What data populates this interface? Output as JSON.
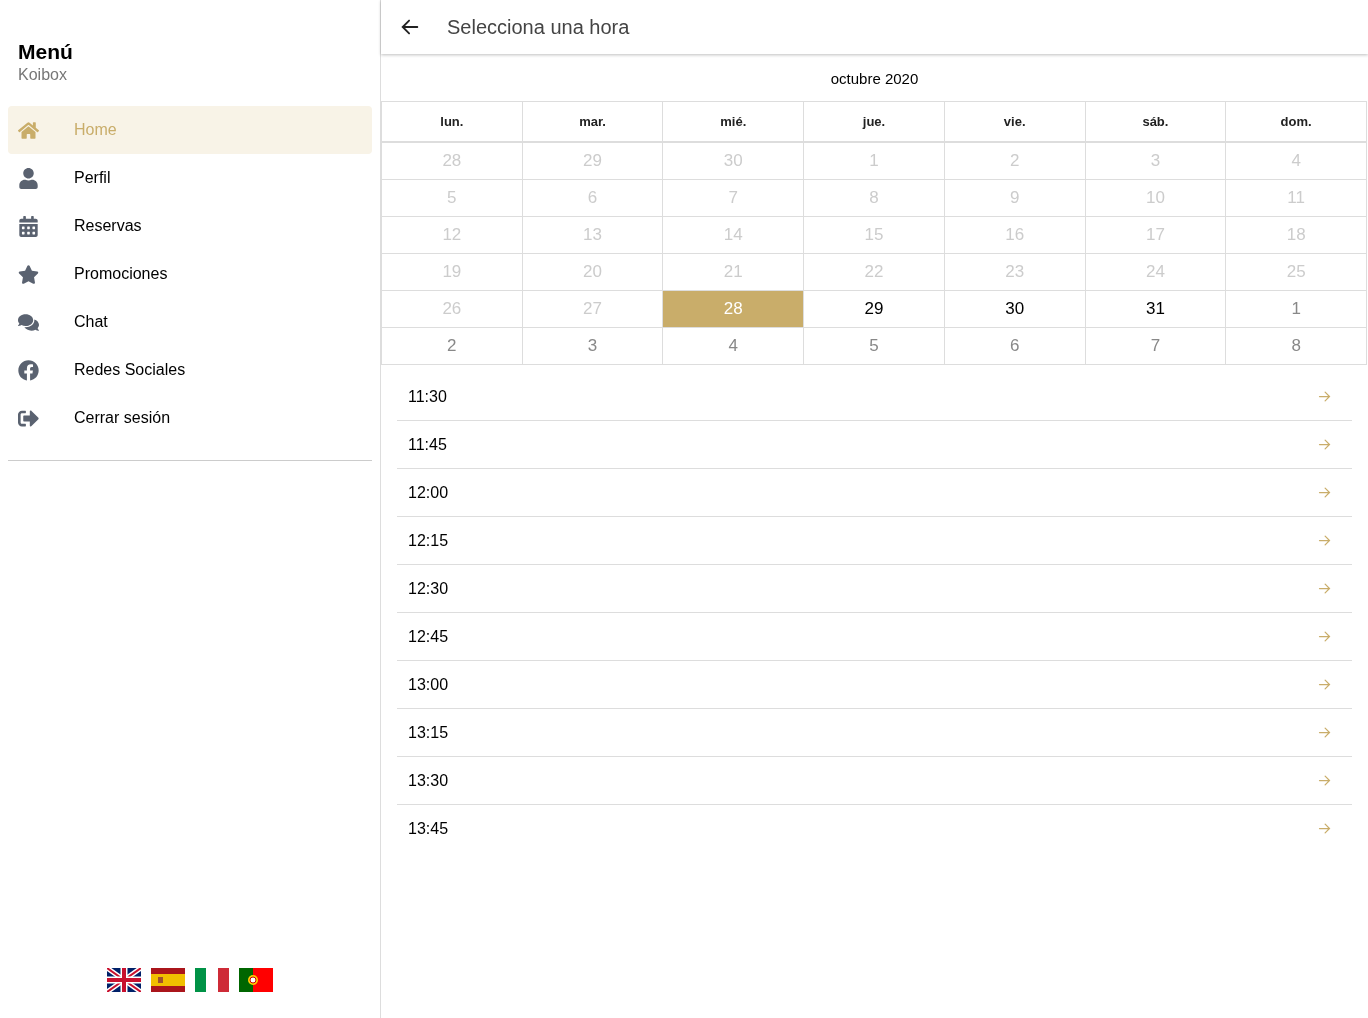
{
  "sidebar": {
    "title": "Menú",
    "subtitle": "Koibox",
    "items": [
      {
        "label": "Home",
        "selected": true
      },
      {
        "label": "Perfil",
        "selected": false
      },
      {
        "label": "Reservas",
        "selected": false
      },
      {
        "label": "Promociones",
        "selected": false
      },
      {
        "label": "Chat",
        "selected": false
      },
      {
        "label": "Redes Sociales",
        "selected": false
      },
      {
        "label": "Cerrar sesión",
        "selected": false
      }
    ]
  },
  "header": {
    "title": "Selecciona una hora"
  },
  "calendar": {
    "month": "octubre 2020",
    "weekdays": [
      "lun.",
      "mar.",
      "mié.",
      "jue.",
      "vie.",
      "sáb.",
      "dom."
    ],
    "weeks": [
      [
        {
          "day": "28",
          "disabled": true,
          "selected": false
        },
        {
          "day": "29",
          "disabled": true,
          "selected": false
        },
        {
          "day": "30",
          "disabled": true,
          "selected": false
        },
        {
          "day": "1",
          "disabled": true,
          "selected": false
        },
        {
          "day": "2",
          "disabled": true,
          "selected": false
        },
        {
          "day": "3",
          "disabled": true,
          "selected": false
        },
        {
          "day": "4",
          "disabled": true,
          "selected": false
        }
      ],
      [
        {
          "day": "5",
          "disabled": true,
          "selected": false
        },
        {
          "day": "6",
          "disabled": true,
          "selected": false
        },
        {
          "day": "7",
          "disabled": true,
          "selected": false
        },
        {
          "day": "8",
          "disabled": true,
          "selected": false
        },
        {
          "day": "9",
          "disabled": true,
          "selected": false
        },
        {
          "day": "10",
          "disabled": true,
          "selected": false
        },
        {
          "day": "11",
          "disabled": true,
          "selected": false
        }
      ],
      [
        {
          "day": "12",
          "disabled": true,
          "selected": false
        },
        {
          "day": "13",
          "disabled": true,
          "selected": false
        },
        {
          "day": "14",
          "disabled": true,
          "selected": false
        },
        {
          "day": "15",
          "disabled": true,
          "selected": false
        },
        {
          "day": "16",
          "disabled": true,
          "selected": false
        },
        {
          "day": "17",
          "disabled": true,
          "selected": false
        },
        {
          "day": "18",
          "disabled": true,
          "selected": false
        }
      ],
      [
        {
          "day": "19",
          "disabled": true,
          "selected": false
        },
        {
          "day": "20",
          "disabled": true,
          "selected": false
        },
        {
          "day": "21",
          "disabled": true,
          "selected": false
        },
        {
          "day": "22",
          "disabled": true,
          "selected": false
        },
        {
          "day": "23",
          "disabled": true,
          "selected": false
        },
        {
          "day": "24",
          "disabled": true,
          "selected": false
        },
        {
          "day": "25",
          "disabled": true,
          "selected": false
        }
      ],
      [
        {
          "day": "26",
          "disabled": true,
          "selected": false
        },
        {
          "day": "27",
          "disabled": true,
          "selected": false
        },
        {
          "day": "28",
          "disabled": false,
          "selected": true
        },
        {
          "day": "29",
          "disabled": false,
          "outside_month": false,
          "selected": false
        },
        {
          "day": "30",
          "disabled": false,
          "outside_month": false,
          "selected": false
        },
        {
          "day": "31",
          "disabled": false,
          "outside_month": false,
          "selected": false
        },
        {
          "day": "1",
          "disabled": false,
          "outside_month": true,
          "selected": false
        }
      ],
      [
        {
          "day": "2",
          "disabled": false,
          "outside_month": true,
          "selected": false
        },
        {
          "day": "3",
          "disabled": false,
          "outside_month": true,
          "selected": false
        },
        {
          "day": "4",
          "disabled": false,
          "outside_month": true,
          "selected": false
        },
        {
          "day": "5",
          "disabled": false,
          "outside_month": true,
          "selected": false
        },
        {
          "day": "6",
          "disabled": false,
          "outside_month": true,
          "selected": false
        },
        {
          "day": "7",
          "disabled": false,
          "outside_month": true,
          "selected": false
        },
        {
          "day": "8",
          "disabled": false,
          "outside_month": true,
          "selected": false
        }
      ]
    ]
  },
  "times": [
    "11:30",
    "11:45",
    "12:00",
    "12:15",
    "12:30",
    "12:45",
    "13:00",
    "13:15",
    "13:30",
    "13:45"
  ]
}
